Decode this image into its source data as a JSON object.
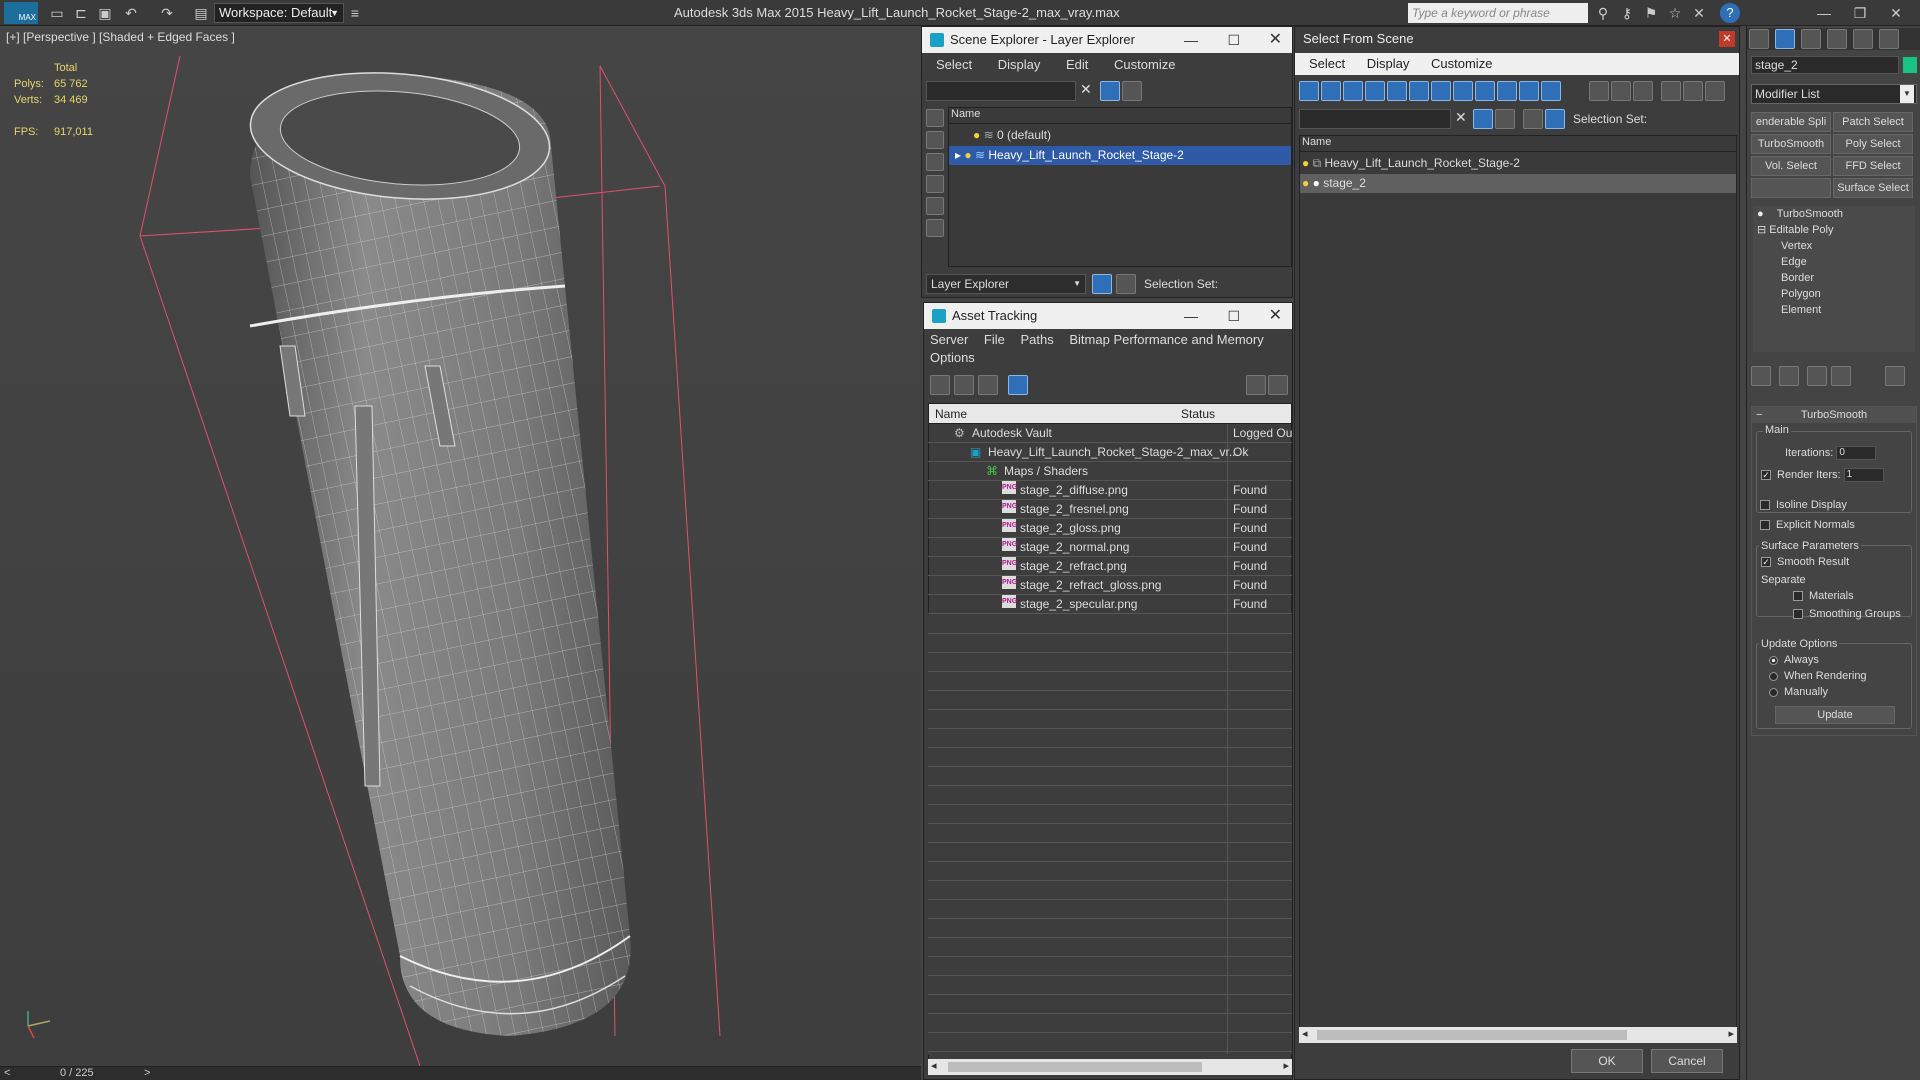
{
  "app": {
    "logo": "MAX",
    "workspace": "Workspace: Default",
    "title": "Autodesk 3ds Max  2015     Heavy_Lift_Launch_Rocket_Stage-2_max_vray.max",
    "search_placeholder": "Type a keyword or phrase",
    "help": "?"
  },
  "viewport": {
    "label": "[+] [Perspective ] [Shaded + Edged Faces ]",
    "stats": {
      "total_label": "Total",
      "polys_label": "Polys:",
      "polys": "65 762",
      "verts_label": "Verts:",
      "verts": "34 469",
      "fps_label": "FPS:",
      "fps": "917,011"
    },
    "frame": "0 / 225"
  },
  "scene_explorer": {
    "title": "Scene Explorer - Layer Explorer",
    "menu": [
      "Select",
      "Display",
      "Edit",
      "Customize"
    ],
    "col_name": "Name",
    "rows": [
      "0 (default)",
      "Heavy_Lift_Launch_Rocket_Stage-2"
    ],
    "footer_dropdown": "Layer Explorer",
    "selection_set": "Selection Set:"
  },
  "asset_tracking": {
    "title": "Asset Tracking",
    "menu": [
      "Server",
      "File",
      "Paths",
      "Bitmap Performance and Memory",
      "Options"
    ],
    "col_name": "Name",
    "col_status": "Status",
    "rows": [
      {
        "name": "Autodesk Vault",
        "status": "Logged Ou"
      },
      {
        "name": "Heavy_Lift_Launch_Rocket_Stage-2_max_vr...",
        "status": "Ok"
      },
      {
        "name": "Maps / Shaders",
        "status": ""
      },
      {
        "name": "stage_2_diffuse.png",
        "status": "Found"
      },
      {
        "name": "stage_2_fresnel.png",
        "status": "Found"
      },
      {
        "name": "stage_2_gloss.png",
        "status": "Found"
      },
      {
        "name": "stage_2_normal.png",
        "status": "Found"
      },
      {
        "name": "stage_2_refract.png",
        "status": "Found"
      },
      {
        "name": "stage_2_refract_gloss.png",
        "status": "Found"
      },
      {
        "name": "stage_2_specular.png",
        "status": "Found"
      }
    ],
    "png_badge": "PNG"
  },
  "select_from_scene": {
    "title": "Select From Scene",
    "menu": [
      "Select",
      "Display",
      "Customize"
    ],
    "selection_set": "Selection Set:",
    "col_name": "Name",
    "rows": [
      "Heavy_Lift_Launch_Rocket_Stage-2",
      "stage_2"
    ],
    "ok": "OK",
    "cancel": "Cancel"
  },
  "command_panel": {
    "object_name": "stage_2",
    "modifier_list": "Modifier List",
    "buttons": [
      "enderable Spli",
      "Patch Select",
      "TurboSmooth",
      "Poly Select",
      "Vol. Select",
      "FFD Select",
      "",
      "Surface Select"
    ],
    "stack": [
      "TurboSmooth",
      "Editable Poly",
      "Vertex",
      "Edge",
      "Border",
      "Polygon",
      "Element"
    ],
    "rollout_title": "TurboSmooth",
    "main_label": "Main",
    "iterations_label": "Iterations:",
    "iterations": "0",
    "render_iters_label": "Render Iters:",
    "render_iters": "1",
    "isoline": "Isoline Display",
    "explicit_normals": "Explicit Normals",
    "surface_params": "Surface Parameters",
    "smooth_result": "Smooth Result",
    "separate": "Separate",
    "materials": "Materials",
    "smoothing_groups": "Smoothing Groups",
    "update_options": "Update Options",
    "always": "Always",
    "when_rendering": "When Rendering",
    "manually": "Manually",
    "update": "Update"
  }
}
